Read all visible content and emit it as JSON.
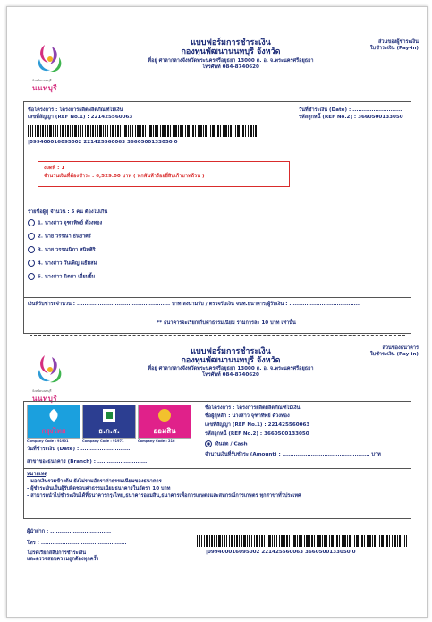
{
  "header1": {
    "logo_text": "นนทบุรี",
    "logo_small": "จังหวัดนนทบุรี",
    "title_line1": "แบบฟอร์มการชำระเงิน",
    "title_line2": "กองทุนพัฒนานนทบุรี จังหวัด",
    "address": "ที่อยู่ ศาลากลางจังหวัดพระนครศรีอยุธยา 13000 ต. อ. จ.พระนครศรีอยุธยา",
    "phone": "โทรศัพท์ 084-8740620",
    "copy_line1": "ส่วนของผู้ชำระเงิน",
    "copy_line2": "ใบชำระเงิน (Pay-in)"
  },
  "section1": {
    "project": "ชื่อโครงการ : โครงการผลิตผลิตภัณฑ์ไม้เงิน",
    "ref1": "เลขที่สัญญา (REF No.1) : 221425560063",
    "date": "วันที่ชำระเงิน (Date) : ..........................",
    "ref2": "รหัสลูกหนี้ (REF No.2) : 3660500133050",
    "barcode_text": "|099400016095002 221425560063 3660500133050 0",
    "installment": "งวดที่ : 1",
    "amount": "จำนวนเงินที่ต้องชำระ : 6,529.00 บาท ( หกพันห้าร้อยยี่สิบเก้าบาทถ้วน )",
    "members_header": "รายชื่อผู้กู้ จำนวน : 5 คน ต้องไม่เกิน",
    "members": [
      "1. นางสาว จุฑาทิพย์ ด้วงทอง",
      "2. นาย วรรณา ธันยาศรี",
      "3. นาย วรรณนิภา สนิทศิริ",
      "4. นางสาว วันเพ็ญ แย้มสม",
      "5. นางสาว นิตยา เอี่ยมยิ้ม"
    ],
    "amount_words": "เงินที่รับชำระจำนวน : ................................................. บาท ลงนามรับ / ตรวจรับเงิน จนท.ธนาคาร/ผู้รับเงิน : .....................................",
    "fee_note": "** ธนาคารจะเรียกเก็บค่าธรรมเนียม รวมการละ 10 บาท เท่านั้น"
  },
  "header2": {
    "logo_text": "นนทบุรี",
    "logo_small": "จังหวัดนนทบุรี",
    "title_line1": "แบบฟอร์มการชำระเงิน",
    "title_line2": "กองทุนพัฒนานนทบุรี จังหวัด",
    "address": "ที่อยู่ ศาลากลางจังหวัดพระนครศรีอยุธยา 13000 ต. อ. จ.พระนครศรีอยุธยา",
    "phone": "โทรศัพท์ 084-8740620",
    "copy_line1": "ส่วนของธนาคาร",
    "copy_line2": "ใบชำระเงิน (Pay-in)"
  },
  "section2": {
    "bank1": "กรุงไทย",
    "bank2": "ธ.ก.ส.",
    "bank3": "ออมสิน",
    "code1": "Company Code : 91901",
    "code2": "Company Code : 91971",
    "code3": "Company Code : 216",
    "date": "วันที่ชำระเงิน (Date) : ..........................",
    "branch": "สาขาของธนาคาร (Branch) : ..........................",
    "project": "ชื่อโครงการ : โครงการผลิตผลิตภัณฑ์ไม้เงิน",
    "borrower": "ชื่อผู้กู้หลัก : นางสาว จุฑาทิพย์ ด้วงทอง",
    "ref1": "เลขที่สัญญา (REF No.1) : 221425560063",
    "ref2": "รหัสลูกหนี้ (REF No.2) : 3660500133050",
    "cash": "เงินสด / Cash",
    "amount": "จำนวนเงินที่รับชำระ (Amount) : .............................................. บาท",
    "notes_header": "หมายเหตุ",
    "notes": [
      "- มอดเงินรวมข้างต้น ยังไม่รวมอัตราค่าธรรมเนียมของธนาคาร",
      "- ผู้ชำระเงินเป็นผู้รับผิดชอบค่าธรรมเนียมธนาคารในอัตรา 10 บาท",
      "- สามารถนำไปชำระเงินได้ที่ธนาคารกรุงไทย,ธนาคารออมสิน,ธนาคารเพื่อการเกษตรและสหกรณ์การเกษตร ทุกสาขาทั่วประเทศ"
    ],
    "payer": "ผู้นำฝาก : ................................",
    "tel": "โทร : .............................................",
    "footer1": "โปรดเรียกสลิปการชำระเงิน",
    "footer2": "และตรวจสอบความถูกต้องทุกครั้ง",
    "barcode_text": "|099400016095002 221425560063 3660500133050 0"
  },
  "colors": {
    "accent": "#d92c2c",
    "text": "#1e2d78",
    "logo_pink": "#d4307f",
    "logo_blue": "#2e9bd6",
    "logo_green": "#3fb550"
  }
}
